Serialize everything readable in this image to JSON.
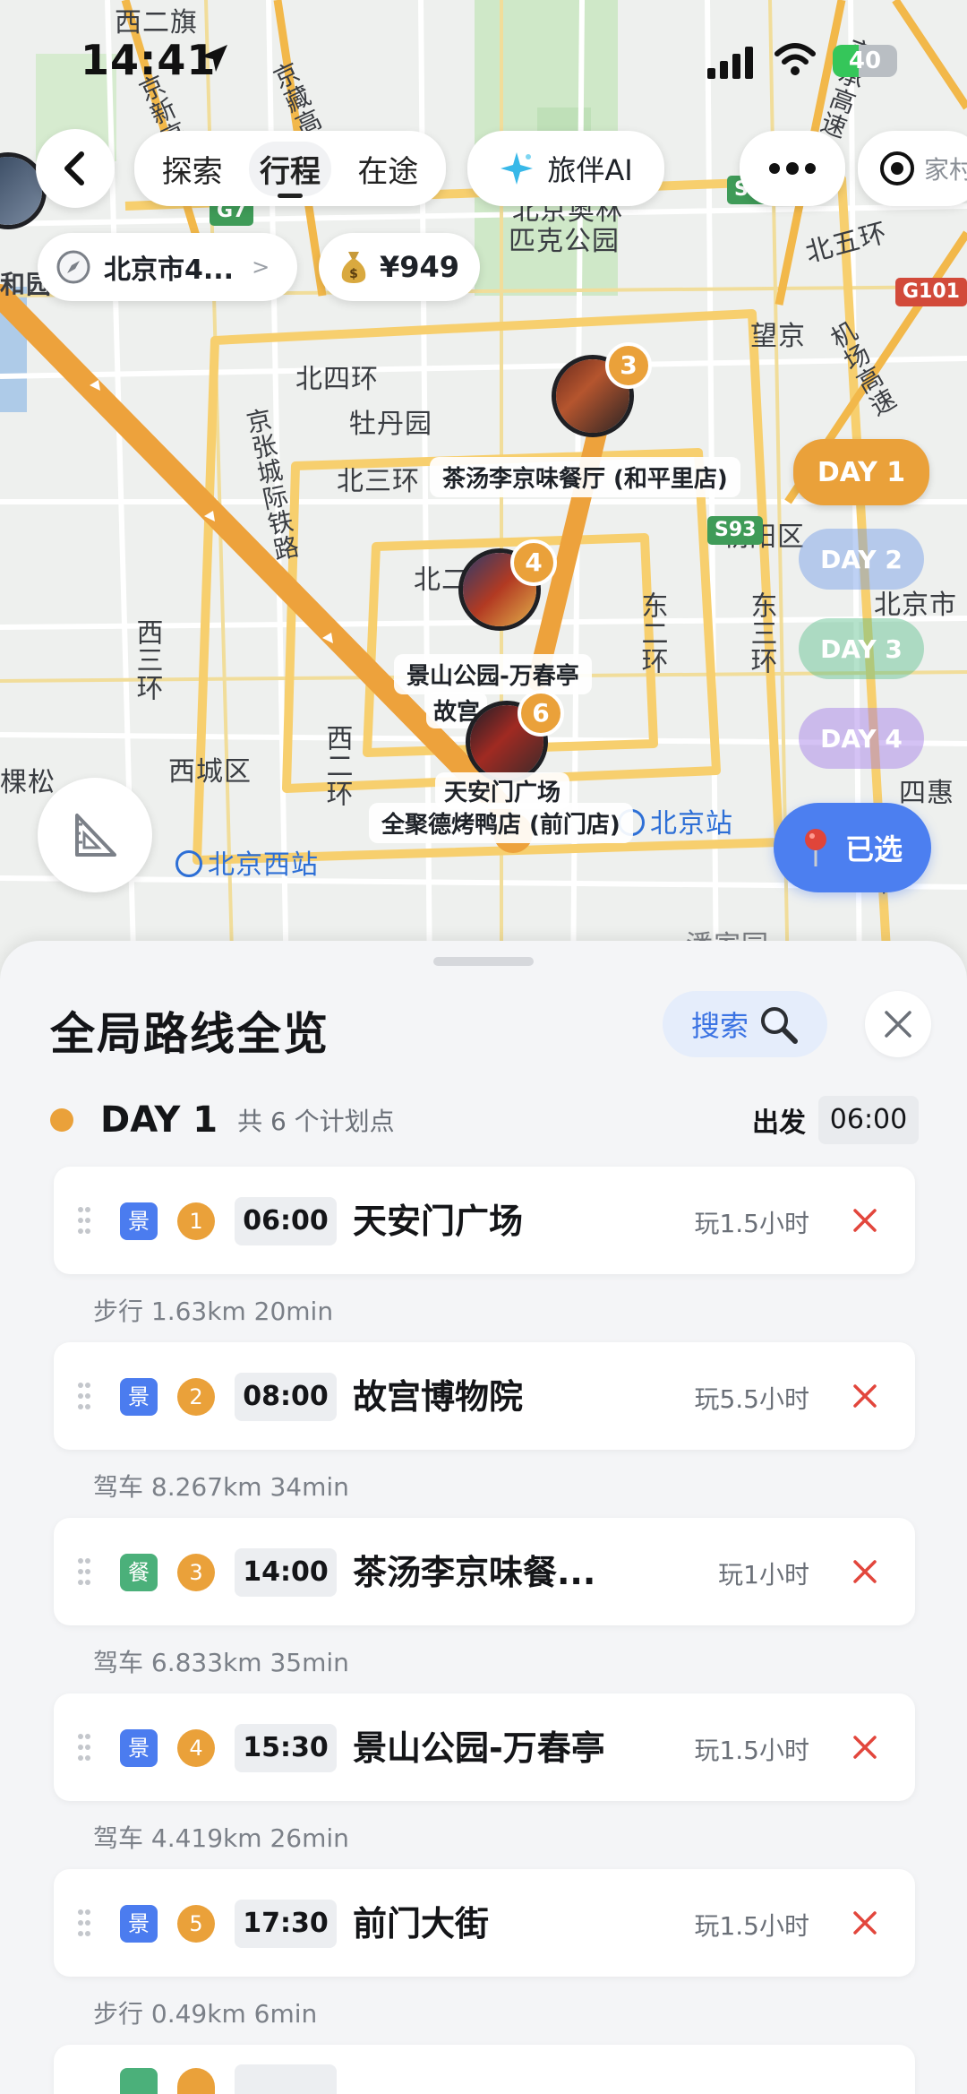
{
  "status_bar": {
    "time": "14:41",
    "battery": "40"
  },
  "toolbar": {
    "tabs": [
      "探索",
      "行程",
      "在途"
    ],
    "ai_label": "旅伴AI",
    "city": "北京市4...",
    "city_chevron": ">",
    "budget": "¥949",
    "target_label": "家村"
  },
  "map": {
    "labels": {
      "xierqi": "西二旗",
      "beijing_olympic": "北京奥林",
      "olympic_park": "匹克公园",
      "beiwuhuan": "北五环",
      "wangjing": "望京",
      "beisihuan": "北四环",
      "mudanyuan": "牡丹园",
      "beisanhuan": "北三环",
      "chaoyang": "朝阳区",
      "beijingshi": "北京市",
      "xisanhuan": "西三环",
      "dongerhuan": "东二环",
      "dongsanhuan": "东三环",
      "xichengqu": "西城区",
      "xierhuan": "西二环",
      "sihui": "四惠",
      "kesong": "棵松",
      "heyuan": "和园",
      "jingzhang_rail": "京张城际铁路",
      "jingcang_hwy": "京藏高速",
      "jingxin_hwy": "京新高速",
      "jingcheng_hwy": "京承高速",
      "airport_hwy": "机场高速",
      "beijing_west": "北京西站",
      "beijing_station": "北京站",
      "panjiayuan": "潘家园",
      "bei2": "北二",
      "huan": "环"
    },
    "shields": {
      "g7": "G7",
      "s11": "S11",
      "g101": "G101",
      "s93": "S93"
    },
    "poi_labels": {
      "p3": "茶汤李京味餐厅 (和平里店)",
      "p4": "景山公园-万春亭",
      "p4b": "故宫",
      "p1": "天安门广场",
      "p6": "全聚德烤鸭店 (前门店)"
    },
    "badges": {
      "b3": "3",
      "b4": "4",
      "b6": "6",
      "b5": "5"
    },
    "day_chips": [
      "DAY 1",
      "DAY 2",
      "DAY 3",
      "DAY 4"
    ],
    "selected_btn": "已选"
  },
  "sheet": {
    "title": "全局路线全览",
    "search_label": "搜索",
    "day": {
      "name": "DAY 1",
      "count": "共 6 个计划点",
      "depart_label": "出发",
      "depart_time": "06:00"
    },
    "items": [
      {
        "tag": "景",
        "order": "1",
        "time": "06:00",
        "name": "天安门广场",
        "duration": "玩1.5小时",
        "segment": "步行 1.63km 20min"
      },
      {
        "tag": "景",
        "order": "2",
        "time": "08:00",
        "name": "故宫博物院",
        "duration": "玩5.5小时",
        "segment": "驾车 8.267km 34min"
      },
      {
        "tag": "餐",
        "order": "3",
        "time": "14:00",
        "name": "茶汤李京味餐...",
        "duration": "玩1小时",
        "segment": "驾车 6.833km 35min"
      },
      {
        "tag": "景",
        "order": "4",
        "time": "15:30",
        "name": "景山公园-万春亭",
        "duration": "玩1.5小时",
        "segment": "驾车 4.419km 26min"
      },
      {
        "tag": "景",
        "order": "5",
        "time": "17:30",
        "name": "前门大街",
        "duration": "玩1.5小时",
        "segment": "步行 0.49km 6min"
      }
    ]
  },
  "colors": {
    "accent_orange": "#eaa13a",
    "brand_blue": "#4c7ff0",
    "delete_red": "#e2463c",
    "food_green": "#4bb07a"
  }
}
